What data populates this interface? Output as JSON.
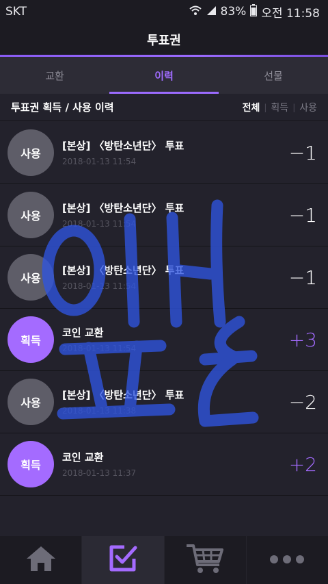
{
  "status": {
    "carrier": "SKT",
    "battery": "83%",
    "time": "오전 11:58"
  },
  "header": {
    "title": "투표권"
  },
  "tabs": [
    {
      "label": "교환",
      "active": false
    },
    {
      "label": "이력",
      "active": true
    },
    {
      "label": "선물",
      "active": false
    }
  ],
  "section": {
    "title": "투표권 획득 / 사용 이력",
    "filters": [
      {
        "label": "전체",
        "active": true
      },
      {
        "label": "획득",
        "active": false
      },
      {
        "label": "사용",
        "active": false
      }
    ]
  },
  "history": [
    {
      "type": "사용",
      "kind": "use",
      "title": "[본상] 〈방탄소년단〉 투표",
      "time": "2018-01-13 11:54",
      "amount": "−1"
    },
    {
      "type": "사용",
      "kind": "use",
      "title": "[본상] 〈방탄소년단〉 투표",
      "time": "2018-01-13 11:54",
      "amount": "−1"
    },
    {
      "type": "사용",
      "kind": "use",
      "title": "[본상] 〈방탄소년단〉 투표",
      "time": "2018-01-13 11:54",
      "amount": "−1"
    },
    {
      "type": "획득",
      "kind": "gain",
      "title": "코인 교환",
      "time": "2018-01-13 11:54",
      "amount": "+3"
    },
    {
      "type": "사용",
      "kind": "use",
      "title": "[본상] 〈방탄소년단〉 투표",
      "time": "2018-01-13 11:38",
      "amount": "−2"
    },
    {
      "type": "획득",
      "kind": "gain",
      "title": "코인 교환",
      "time": "2018-01-13 11:37",
      "amount": "+2"
    }
  ],
  "nav": [
    {
      "icon": "home-icon",
      "active": false
    },
    {
      "icon": "vote-check-icon",
      "active": true
    },
    {
      "icon": "cart-icon",
      "active": false
    },
    {
      "icon": "more-icon",
      "active": false
    }
  ],
  "colors": {
    "accent": "#a46bff",
    "background": "#23222c",
    "use_circle": "#5e5d68",
    "watermark": "#2f55e0"
  }
}
